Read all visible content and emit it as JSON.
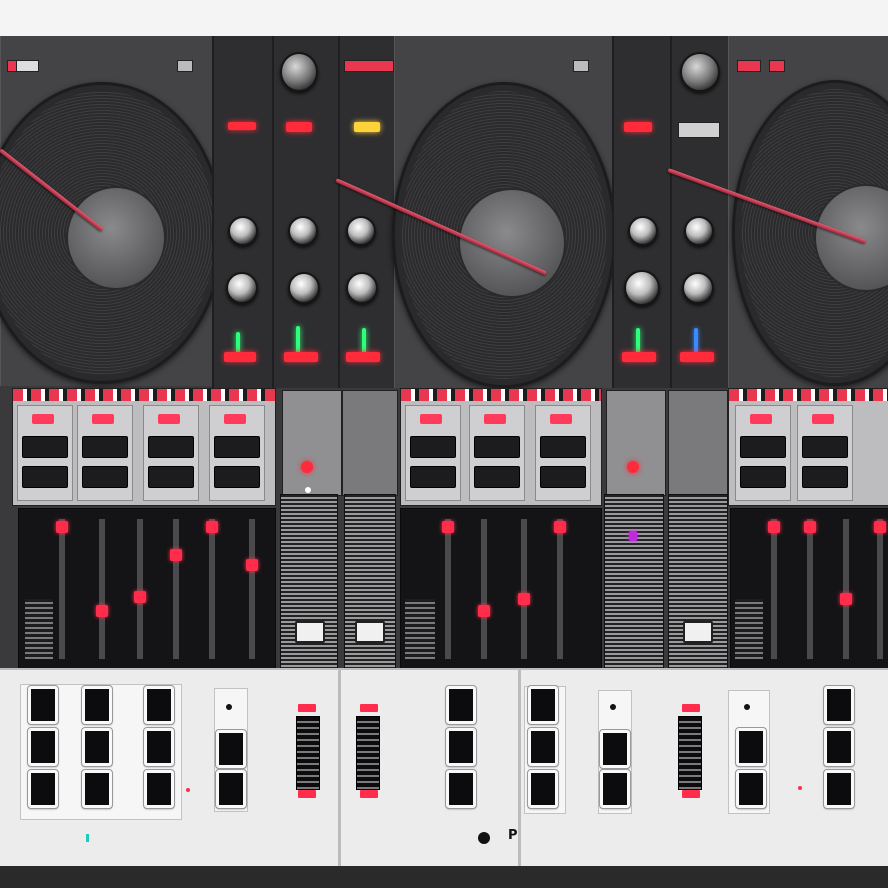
{
  "device": {
    "type": "dj-controller",
    "decks": [
      {
        "id": "deck-left"
      },
      {
        "id": "deck-center"
      },
      {
        "id": "deck-right"
      }
    ]
  },
  "colors": {
    "body": "#3a3a3c",
    "accent_red": "#ff2a3a",
    "accent_green": "#2dff7a",
    "panel_light": "#ececec"
  },
  "icons": [
    "platter-icon",
    "tonearm-icon",
    "knob-icon",
    "led-indicator",
    "pad-button",
    "fader-cap",
    "pitch-slider"
  ]
}
